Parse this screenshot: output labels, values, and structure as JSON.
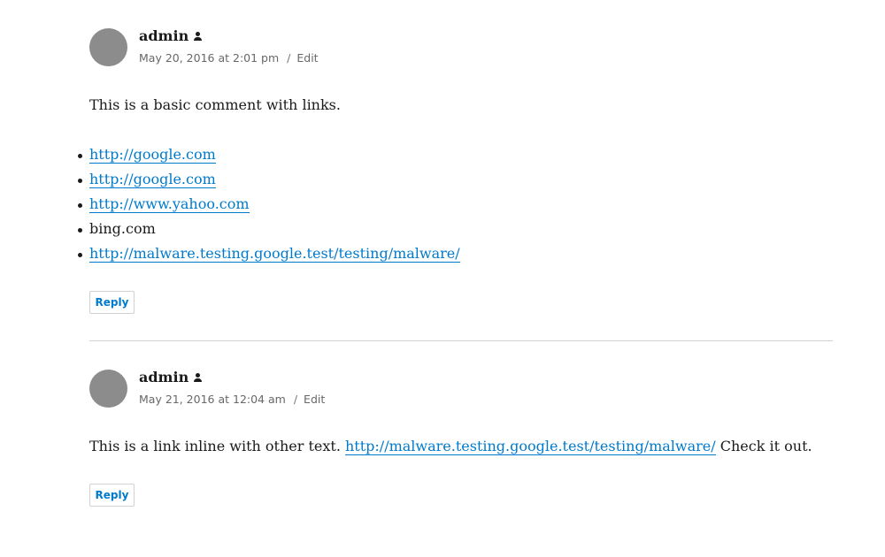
{
  "comments": [
    {
      "author": "admin",
      "date": "May 20, 2016 at 2:01 pm",
      "edit": "Edit",
      "text": "This is a basic comment with links.",
      "links": [
        {
          "text": "http://google.com",
          "is_link": true
        },
        {
          "text": "http://google.com",
          "is_link": true
        },
        {
          "text": "http://www.yahoo.com",
          "is_link": true
        },
        {
          "text": "bing.com",
          "is_link": false
        },
        {
          "text": "http://malware.testing.google.test/testing/malware/",
          "is_link": true
        }
      ],
      "reply": "Reply"
    },
    {
      "author": "admin",
      "date": "May 21, 2016 at 12:04 am",
      "edit": "Edit",
      "text_before": "This is a link inline with other text.",
      "inline_link": "http://malware.testing.google.test/testing/malware/",
      "text_after": "Check it out.",
      "reply": "Reply"
    }
  ],
  "colors": {
    "link": "#007acc",
    "avatar": "#8c8c8c",
    "meta": "#686868",
    "border": "#d1d1d1"
  },
  "icons": {
    "author_badge": "user-icon"
  }
}
